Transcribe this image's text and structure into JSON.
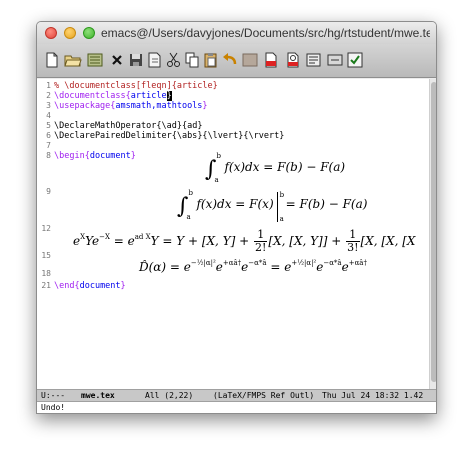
{
  "window": {
    "title": "emacs@/Users/davyjones/Documents/src/hg/rtstudent/mwe.tex"
  },
  "toolbar": {
    "icons": [
      "new-file-icon",
      "open-folder-icon",
      "dired-icon",
      "close-buffer-icon",
      "save-icon",
      "save-as-icon",
      "cut-icon",
      "copy-icon",
      "paste-icon",
      "undo-icon",
      "preferences-icon",
      "latex-pdf-icon",
      "view-pdf-icon",
      "spell-check-icon",
      "help-icon",
      "info-icon"
    ]
  },
  "editor": {
    "lines": [
      {
        "num": "1",
        "parts": [
          "%",
          " \\documentclass[fleqn]{article}"
        ]
      },
      {
        "num": "2",
        "parts": [
          "\\documentclass{",
          "article",
          "}"
        ]
      },
      {
        "num": "3",
        "parts": [
          "\\usepackage{",
          "amsmath,mathtools",
          "}"
        ]
      },
      {
        "num": "4",
        "parts": [
          ""
        ]
      },
      {
        "num": "5",
        "parts": [
          "\\DeclareMathOperator{",
          "\\ad",
          "}{",
          "ad",
          "}"
        ]
      },
      {
        "num": "6",
        "parts": [
          "\\DeclarePairedDelimiter{",
          "\\abs",
          "}{",
          "\\lvert",
          "}{",
          "\\rvert",
          "}"
        ]
      },
      {
        "num": "7",
        "parts": [
          ""
        ]
      },
      {
        "num": "8",
        "parts": [
          "\\begin{",
          "document",
          "}"
        ]
      },
      {
        "num": "9"
      },
      {
        "num": "12"
      },
      {
        "num": "15"
      },
      {
        "num": "18"
      },
      {
        "num": "21",
        "parts": [
          "\\end{",
          "document",
          "}"
        ]
      }
    ],
    "equations": {
      "eq1": {
        "int_upper": "b",
        "int_lower": "a",
        "body": "f(x)dx = F(b) − F(a)"
      },
      "eq2": {
        "int_upper": "b",
        "int_lower": "a",
        "left": "f(x)dx = F(x)",
        "eval_upper": "b",
        "eval_lower": "a",
        "right": "= F(b) − F(a)"
      },
      "eq3": {
        "t1": "e",
        "t1sup": "X",
        "t2": "Y",
        "t3": "e",
        "t3sup": "−X",
        "t4": " = e",
        "t4sup": "ad X",
        "t5": "Y = Y + [X, Y] + ",
        "f1num": "1",
        "f1den": "2!",
        "t6": "[X, [X, Y]] + ",
        "f2num": "1",
        "f2den": "3!",
        "t7": "[X, [X, [X"
      },
      "eq4": {
        "lhs": "D̂(α) = e",
        "s1": "−½|α|²",
        "m1": "e",
        "s2": "+αâ†",
        "m2": "e",
        "s3": "−α*â",
        "m3": " = e",
        "s4": "+½|α|²",
        "m4": "e",
        "s5": "−α*â",
        "m5": "e",
        "s6": "+αâ†"
      }
    }
  },
  "modeline": {
    "status": "U:---",
    "buffer": "mwe.tex",
    "position": "All (2,22)",
    "mode": "(LaTeX/FMPS Ref Outl)",
    "datetime": "Thu Jul 24 18:32 1.42"
  },
  "minibuffer": {
    "message": "Undo!"
  }
}
